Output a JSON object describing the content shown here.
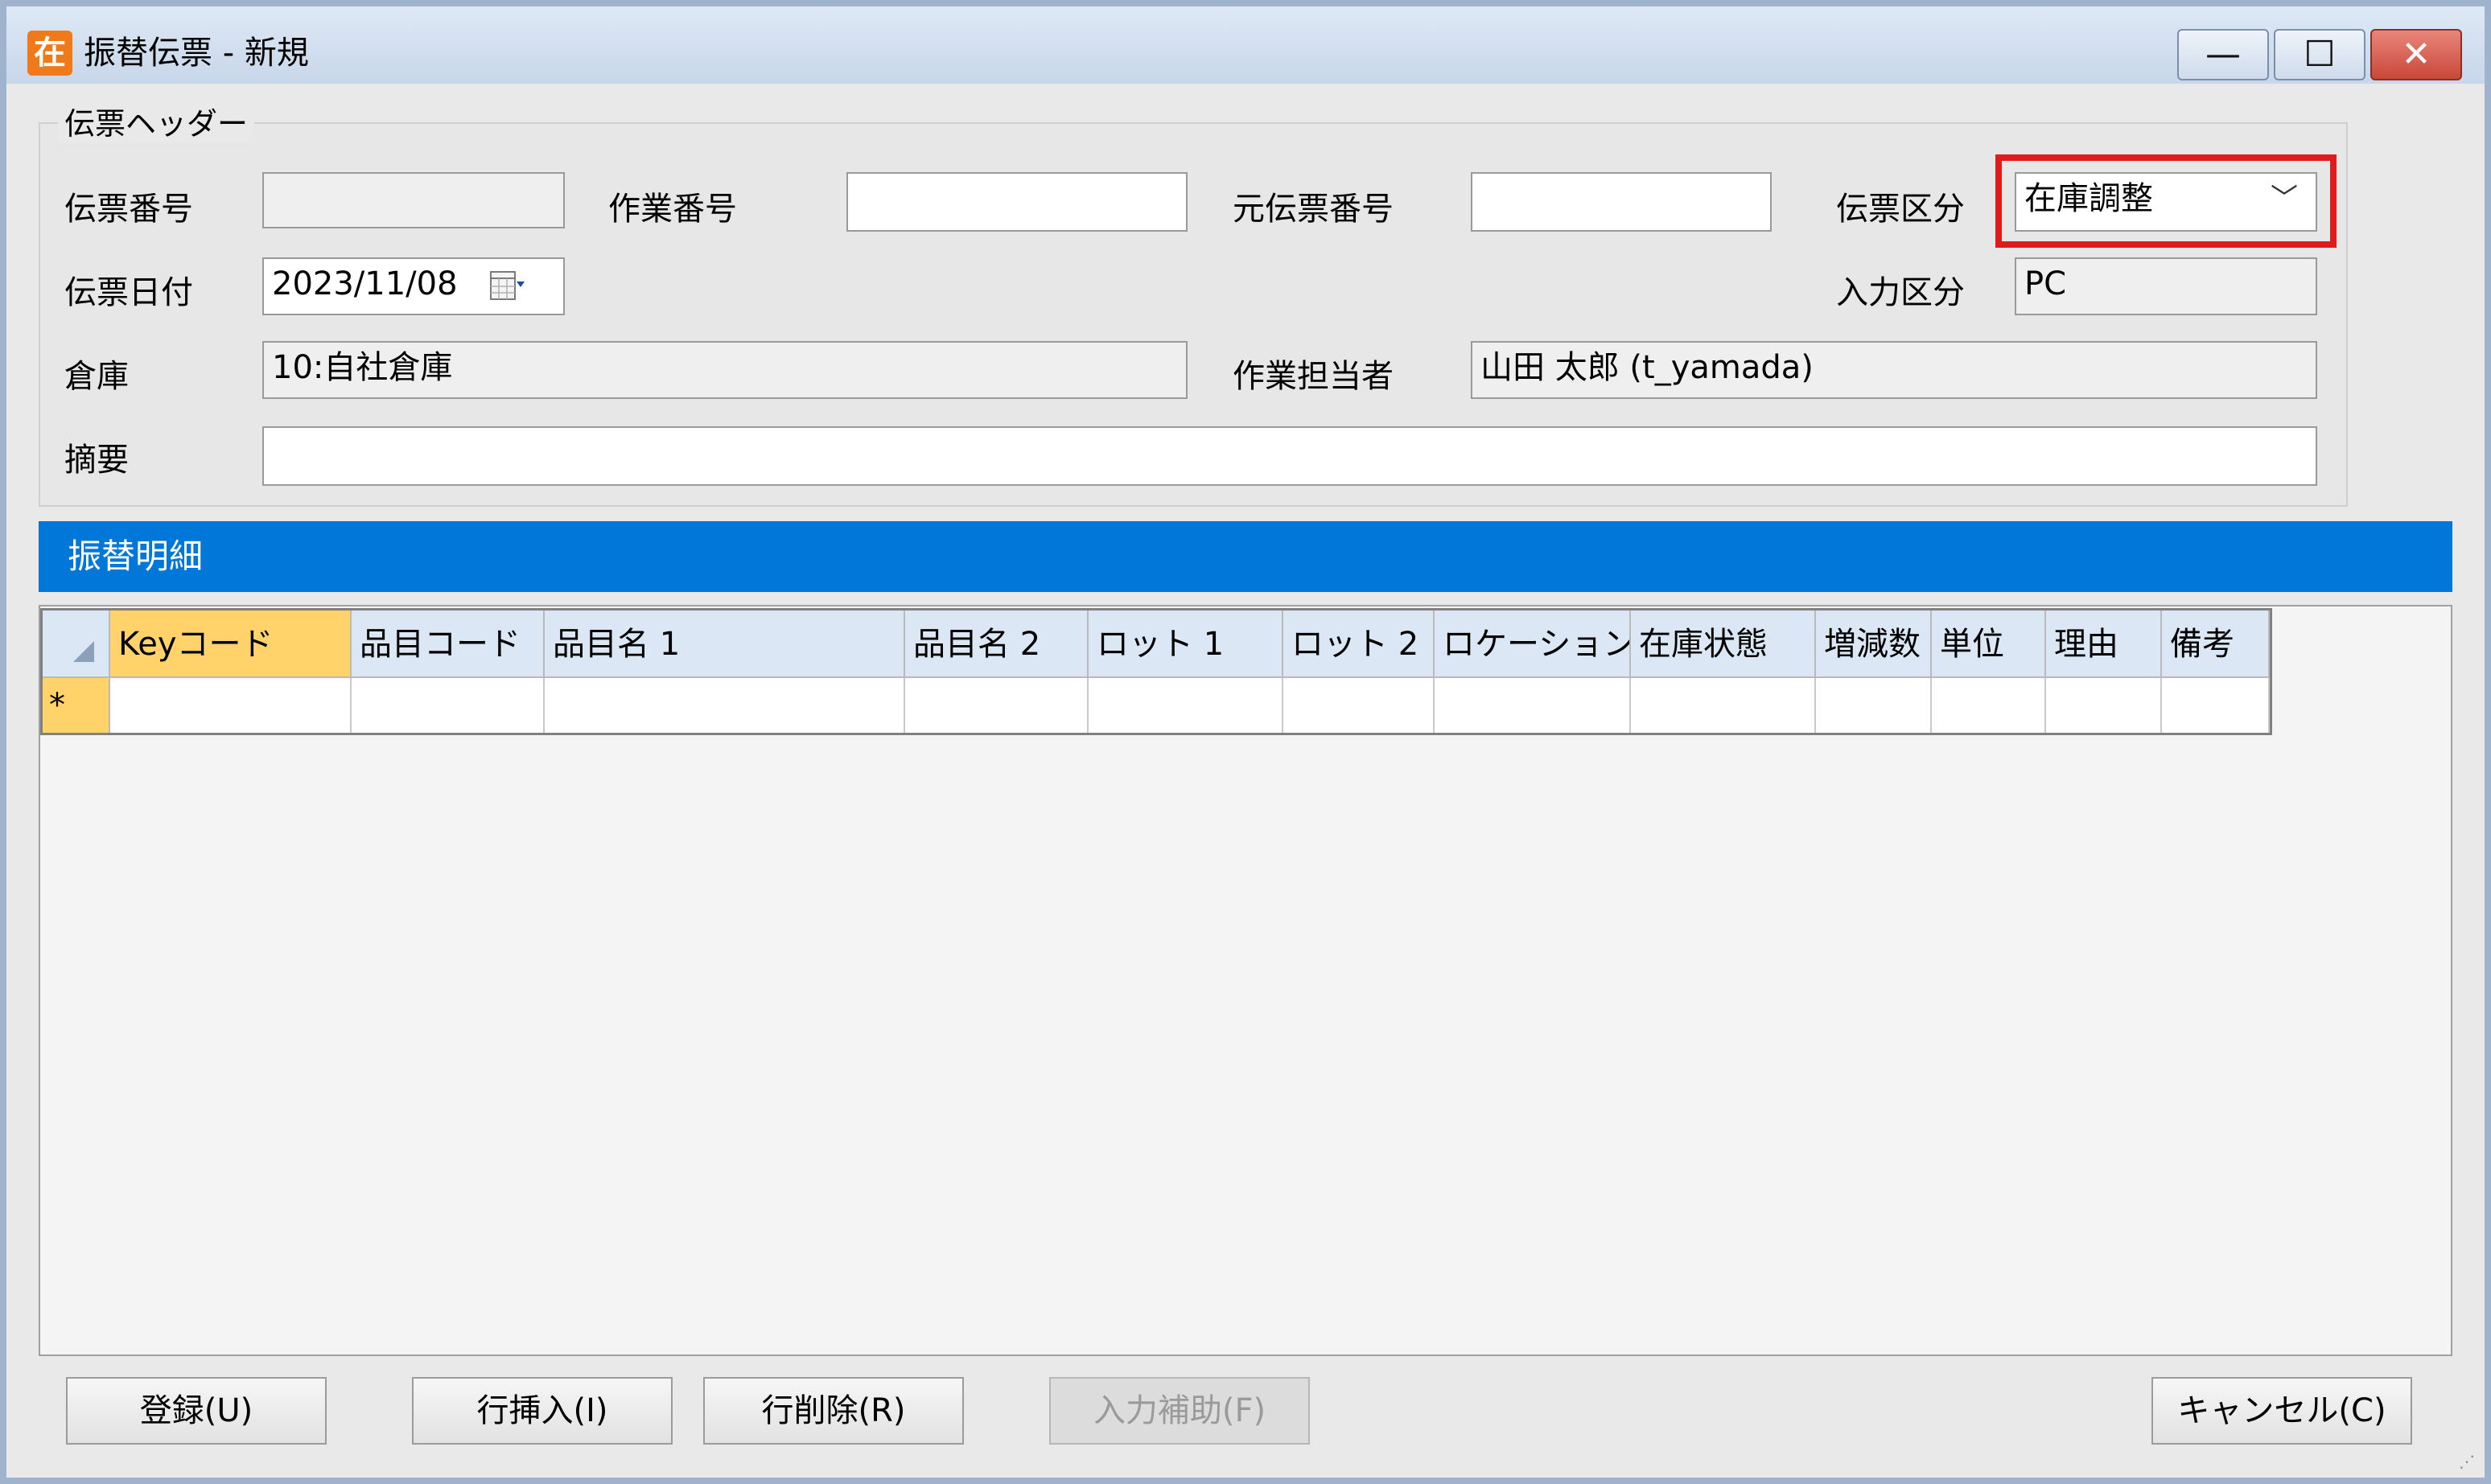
{
  "window": {
    "title": "振替伝票 - 新規",
    "app_icon_char": "在",
    "controls": {
      "minimize": "—",
      "maximize": "☐",
      "close": "✕"
    }
  },
  "header": {
    "group_title": "伝票ヘッダー",
    "slip_no": {
      "label": "伝票番号",
      "value": ""
    },
    "work_no": {
      "label": "作業番号",
      "value": ""
    },
    "orig_slip_no": {
      "label": "元伝票番号",
      "value": ""
    },
    "slip_type": {
      "label": "伝票区分",
      "value": "在庫調整"
    },
    "slip_date": {
      "label": "伝票日付",
      "value": "2023/11/08"
    },
    "input_type": {
      "label": "入力区分",
      "value": "PC"
    },
    "warehouse": {
      "label": "倉庫",
      "value": "10:自社倉庫"
    },
    "worker": {
      "label": "作業担当者",
      "value": "山田 太郎 (t_yamada)"
    },
    "summary": {
      "label": "摘要",
      "value": ""
    }
  },
  "detail": {
    "section_title": "振替明細",
    "columns": [
      "Keyコード",
      "品目コード",
      "品目名 1",
      "品目名 2",
      "ロット 1",
      "ロット 2",
      "ロケーション",
      "在庫状態",
      "増減数",
      "単位",
      "理由",
      "備考"
    ],
    "new_row_marker": "*"
  },
  "footer": {
    "register": "登録(U)",
    "insert_row": "行挿入(I)",
    "delete_row": "行削除(R)",
    "input_assist": "入力補助(F)",
    "cancel": "キャンセル(C)"
  },
  "icons": {
    "calendar": "calendar-icon",
    "dropdown": "chevron-down-icon"
  },
  "colors": {
    "section_bar": "#0077d9",
    "highlight_border": "#e01b1b",
    "key_column": "#ffd36a",
    "app_icon": "#f07a1a"
  }
}
